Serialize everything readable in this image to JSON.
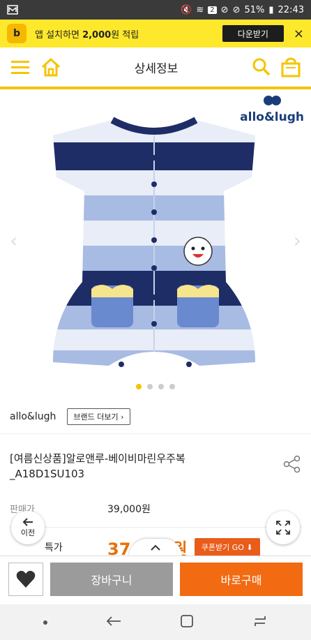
{
  "status_bar": {
    "battery": "51%",
    "time": "22:43",
    "badge": "2"
  },
  "banner": {
    "logo_text": "b",
    "message_pre": "앱 설치하면 ",
    "message_bold": "2,000",
    "message_post": "원 적립",
    "download_label": "다운받기",
    "close_label": "×"
  },
  "nav": {
    "title": "상세정보"
  },
  "gallery": {
    "brand_logo": "allo&lugh",
    "active_index": 0,
    "count": 4
  },
  "product": {
    "brand": "allo&lugh",
    "brand_more": "브랜드 더보기",
    "name_line1": "[여름신상품]알로앤루-베이비마린우주복",
    "name_line2": "_A18D1SU103",
    "price_label": "판매가",
    "price_value": "39,000원",
    "special_label": "이전 특가",
    "special_visible_label": "특가",
    "special_price": "37,500원",
    "coupon_label": "쿠폰받기 GO"
  },
  "floating": {
    "back_label": "이전"
  },
  "bottom": {
    "cart_label": "장바구니",
    "buy_label": "바로구매"
  },
  "colors": {
    "brand_yellow": "#f5c400",
    "buy_orange": "#f26b12",
    "price_orange": "#e8710a"
  }
}
